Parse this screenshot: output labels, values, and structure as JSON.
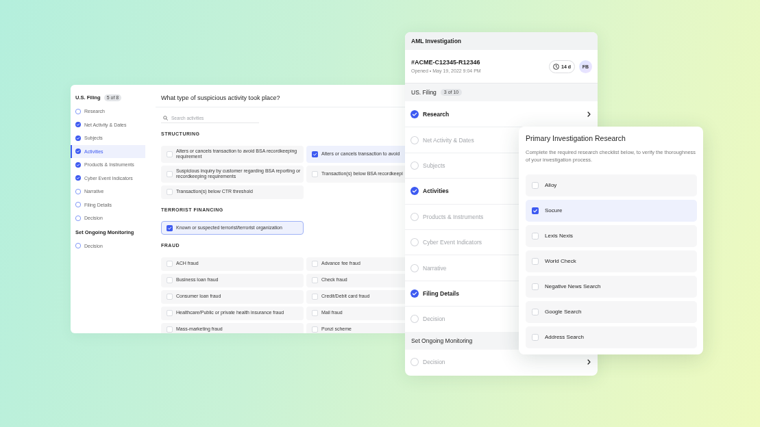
{
  "left_panel": {
    "sidebar": {
      "sections": [
        {
          "title": "U.S. Filing",
          "badge": "5 of 8",
          "items": [
            {
              "label": "Research",
              "done": false,
              "selected": false
            },
            {
              "label": "Net Activity & Dates",
              "done": true,
              "selected": false
            },
            {
              "label": "Subjects",
              "done": true,
              "selected": false
            },
            {
              "label": "Activities",
              "done": true,
              "selected": true
            },
            {
              "label": "Products & Instruments",
              "done": true,
              "selected": false
            },
            {
              "label": "Cyber Event Indicators",
              "done": true,
              "selected": false
            },
            {
              "label": "Narrative",
              "done": false,
              "selected": false
            },
            {
              "label": "Filing Details",
              "done": false,
              "selected": false
            },
            {
              "label": "Decision",
              "done": false,
              "selected": false
            }
          ]
        },
        {
          "title": "Set Ongoing Monitoring",
          "items": [
            {
              "label": "Decision",
              "done": false,
              "selected": false
            }
          ]
        }
      ]
    },
    "question": "What type of suspicious activity took place?",
    "search": {
      "placeholder": "Search activities"
    },
    "groups": [
      {
        "title": "STRUCTURING",
        "options": [
          {
            "label": "Alters or cancels transaction to avoid BSA recordkeeping requirement",
            "checked": false,
            "focused": false
          },
          {
            "label": "Alters or cancels transaction to avoid",
            "checked": true,
            "focused": false
          },
          {
            "label": "Suspicious inquiry by customer regarding BSA reporting or recordkeeping requirements",
            "checked": false,
            "focused": false
          },
          {
            "label": "Transaction(s) below BSA recordkeepi",
            "checked": false,
            "focused": false
          },
          {
            "label": "Transaction(s) below CTR threshold",
            "checked": false,
            "focused": false
          }
        ]
      },
      {
        "title": "TERRORIST FINANCING",
        "options": [
          {
            "label": "Known or suspected terrorist/terrorist organization",
            "checked": true,
            "focused": true
          }
        ]
      },
      {
        "title": "FRAUD",
        "options": [
          {
            "label": "ACH fraud",
            "checked": false,
            "focused": false
          },
          {
            "label": "Advance fee fraud",
            "checked": false,
            "focused": false
          },
          {
            "label": "Business loan fraud",
            "checked": false,
            "focused": false
          },
          {
            "label": "Check fraud",
            "checked": false,
            "focused": false
          },
          {
            "label": "Consumer loan fraud",
            "checked": false,
            "focused": false
          },
          {
            "label": "Credit/Debit card fraud",
            "checked": false,
            "focused": false
          },
          {
            "label": "Healthcare/Public or private health insurance fraud",
            "checked": false,
            "focused": false
          },
          {
            "label": "Mail fraud",
            "checked": false,
            "focused": false
          },
          {
            "label": "Mass-marketing fraud",
            "checked": false,
            "focused": false
          },
          {
            "label": "Ponzi scheme",
            "checked": false,
            "focused": false
          }
        ]
      }
    ]
  },
  "investigation_panel": {
    "title": "AML Investigation",
    "case_id": "#ACME-C12345-R12346",
    "opened": "Opened • May 19, 2022 9:04 PM",
    "age": "14 d",
    "avatar": "FB",
    "sections": [
      {
        "title": "US. Filing",
        "badge": "3 of 10",
        "steps": [
          {
            "label": "Research",
            "done": true
          },
          {
            "label": "Net Activity & Dates",
            "done": false
          },
          {
            "label": "Subjects",
            "done": false
          },
          {
            "label": "Activities",
            "done": true
          },
          {
            "label": "Products & Instruments",
            "done": false
          },
          {
            "label": "Cyber Event Indicators",
            "done": false
          },
          {
            "label": "Narrative",
            "done": false
          },
          {
            "label": "Filing Details",
            "done": true
          },
          {
            "label": "Decision",
            "done": false
          }
        ]
      },
      {
        "title": "Set Ongoing Monitoring",
        "steps": [
          {
            "label": "Decision",
            "done": false
          }
        ]
      }
    ]
  },
  "research_panel": {
    "title": "Primary Investigation Research",
    "description": "Complete the required research checklist below, to verify the thoroughness of your investigation process.",
    "items": [
      {
        "label": "Alloy",
        "checked": false
      },
      {
        "label": "Socure",
        "checked": true
      },
      {
        "label": "Lexis Nexis",
        "checked": false
      },
      {
        "label": "World Check",
        "checked": false
      },
      {
        "label": "Negative News Search",
        "checked": false
      },
      {
        "label": "Google Search",
        "checked": false
      },
      {
        "label": "Address Search",
        "checked": false
      }
    ]
  }
}
